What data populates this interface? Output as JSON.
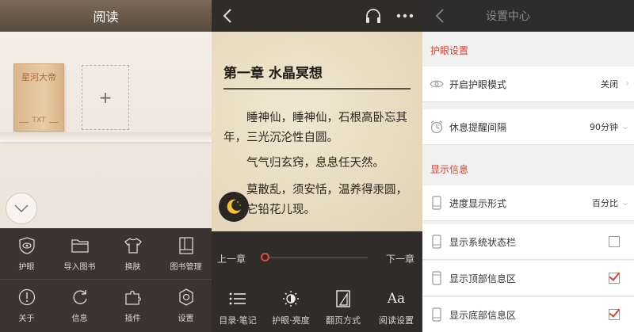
{
  "library": {
    "title": "阅读",
    "book": {
      "title": "星河大帝",
      "type": "TXT"
    },
    "add_symbol": "+",
    "menu": [
      {
        "label": "护眼",
        "icon": "eye-shield-icon"
      },
      {
        "label": "导入图书",
        "icon": "folder-icon"
      },
      {
        "label": "换肤",
        "icon": "tshirt-icon"
      },
      {
        "label": "图书管理",
        "icon": "book-manage-icon"
      },
      {
        "label": "关于",
        "icon": "info-circle-icon"
      },
      {
        "label": "信息",
        "icon": "refresh-icon"
      },
      {
        "label": "插件",
        "icon": "puzzle-icon"
      },
      {
        "label": "设置",
        "icon": "gear-icon"
      }
    ]
  },
  "reader": {
    "chapter_title": "第一章 水晶冥想",
    "paragraphs": [
      "睡神仙，睡神仙，石根高卧忘其年，三光沉沦性自圆。",
      "气气归玄窍，息息任天然。",
      "莫散乱，须安恬，温养得汞圆，等待它铅花儿现。"
    ],
    "prev_chapter": "上一章",
    "next_chapter": "下一章",
    "progress_fraction": 0.0,
    "toolbar": [
      {
        "label": "目录·笔记",
        "icon": "list-icon"
      },
      {
        "label": "护眼·亮度",
        "icon": "brightness-icon"
      },
      {
        "label": "翻页方式",
        "icon": "page-turn-icon"
      },
      {
        "label": "阅读设置",
        "icon": "font-icon"
      }
    ],
    "font_icon_text": "Aa"
  },
  "settings": {
    "title": "设置中心",
    "sections": [
      {
        "title": "护眼设置"
      },
      {
        "title": "显示信息"
      }
    ],
    "rows": [
      {
        "label": "开启护眼模式",
        "value": "关闭",
        "icon": "eye-icon"
      },
      {
        "label": "休息提醒间隔",
        "value": "90分钟",
        "icon": "alarm-clock-icon"
      },
      {
        "label": "进度显示形式",
        "value": "百分比",
        "icon": "phone-icon"
      },
      {
        "label": "显示系统状态栏",
        "checked": false,
        "icon": "phone-icon"
      },
      {
        "label": "显示顶部信息区",
        "checked": true,
        "icon": "phone-icon"
      },
      {
        "label": "显示底部信息区",
        "checked": true,
        "icon": "phone-icon"
      }
    ],
    "accent_color": "#e0402e"
  }
}
